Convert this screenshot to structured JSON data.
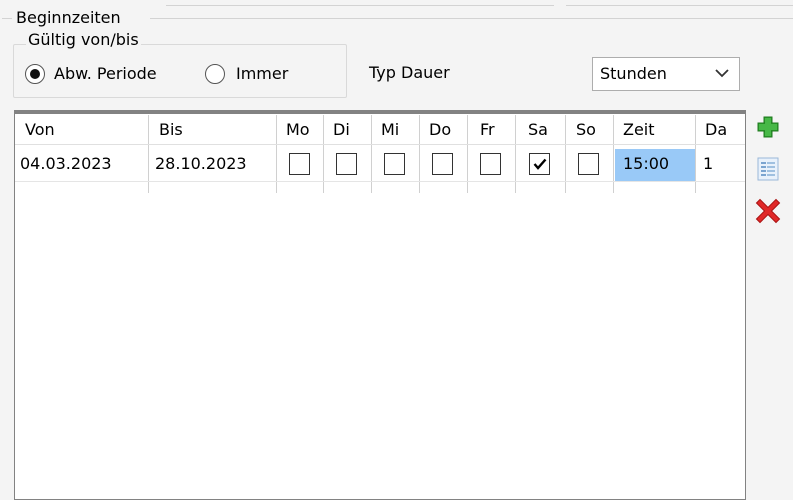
{
  "group": {
    "title": "Beginnzeiten"
  },
  "period": {
    "title": "Gültig von/bis",
    "options": [
      {
        "label": "Abw. Periode",
        "selected": true
      },
      {
        "label": "Immer",
        "selected": false
      }
    ]
  },
  "duration": {
    "label": "Typ Dauer",
    "selected": "Stunden"
  },
  "table": {
    "columns": [
      "Von",
      "Bis",
      "Mo",
      "Di",
      "Mi",
      "Do",
      "Fr",
      "Sa",
      "So",
      "Zeit",
      "Da"
    ],
    "rows": [
      {
        "von": "04.03.2023",
        "bis": "28.10.2023",
        "days": [
          false,
          false,
          false,
          false,
          false,
          true,
          false
        ],
        "zeit": "15:00",
        "da": "1"
      }
    ]
  },
  "colors": {
    "selection": "#99c9f7",
    "add": "#2e9e2e",
    "delete": "#d42020"
  },
  "icons": [
    "add-icon",
    "list-icon",
    "delete-icon",
    "chevron-down-icon",
    "checkmark-icon"
  ]
}
